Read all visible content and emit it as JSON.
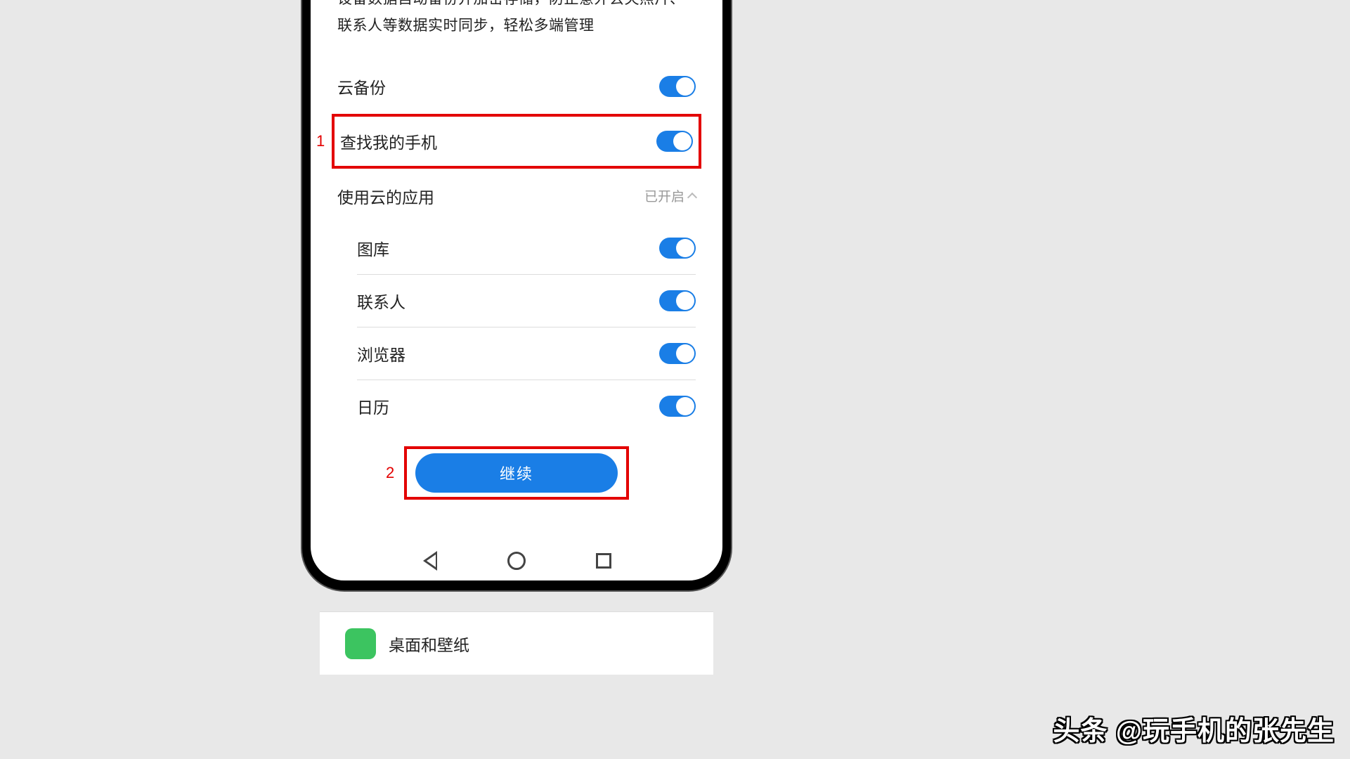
{
  "description": "设备数据自动备份并加密存储，防止意外丢失照片、联系人等数据实时同步，轻松多端管理",
  "settings": {
    "cloud_backup": {
      "label": "云备份",
      "on": true
    },
    "find_phone": {
      "label": "查找我的手机",
      "on": true
    },
    "apps_section": {
      "label": "使用云的应用",
      "status": "已开启",
      "items": [
        {
          "label": "图库",
          "on": true
        },
        {
          "label": "联系人",
          "on": true
        },
        {
          "label": "浏览器",
          "on": true
        },
        {
          "label": "日历",
          "on": true
        }
      ]
    }
  },
  "continue_label": "继续",
  "annotations": {
    "one": "1",
    "two": "2"
  },
  "below_item": {
    "label": "桌面和壁纸"
  },
  "watermark": "头条 @玩手机的张先生",
  "colors": {
    "accent": "#1a7ee6",
    "highlight": "#e30000",
    "green_icon": "#3cc460"
  }
}
